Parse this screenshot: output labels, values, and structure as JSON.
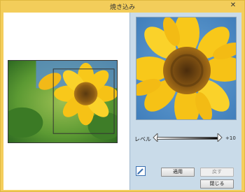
{
  "window": {
    "title": "焼き込み",
    "close_glyph": "✕"
  },
  "tool": {
    "level_label": "レベル",
    "level_value": "+10",
    "level_fraction": 1.0
  },
  "buttons": {
    "apply": "適用",
    "undo": "戻す",
    "close": "閉じる"
  },
  "icons": {
    "brush": "pencil-icon"
  },
  "colors": {
    "title_bar": "#f3cd5a",
    "right_panel": "#c9dbe9",
    "accent_blue": "#3a6fb0"
  }
}
